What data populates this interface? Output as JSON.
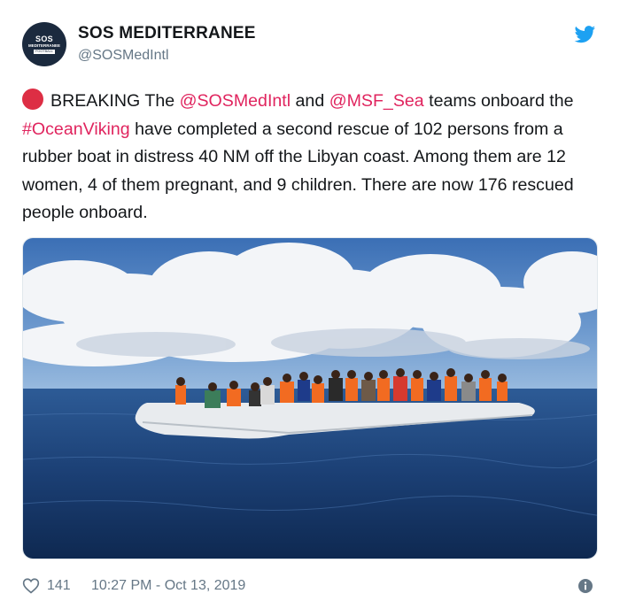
{
  "account": {
    "name": "SOS MEDITERRANEE",
    "handle": "@SOSMedIntl",
    "avatar_line1": "SOS",
    "avatar_line2": "MEDITERRANEE",
    "avatar_line3": "FOOTBALL"
  },
  "tweet": {
    "emoji": "red-circle",
    "segments": [
      {
        "text": "BREAKING The ",
        "link": false
      },
      {
        "text": "@SOSMedIntl",
        "link": true
      },
      {
        "text": " and ",
        "link": false
      },
      {
        "text": "@MSF_Sea",
        "link": true
      },
      {
        "text": " teams onboard the ",
        "link": false
      },
      {
        "text": "#OceanViking",
        "link": true
      },
      {
        "text": " have completed a second rescue of 102 persons from a rubber boat in distress 40 NM off the Libyan coast. Among them are 12 women, 4 of them pregnant, and 9 children. There are now 176 rescued people onboard.",
        "link": false
      }
    ]
  },
  "footer": {
    "likes": "141",
    "timestamp": "10:27 PM - Oct 13, 2019"
  },
  "icons": {
    "brand": "twitter-bird-icon",
    "like": "heart-icon",
    "info": "info-icon"
  },
  "colors": {
    "link": "#e0245e",
    "twitter_blue": "#1da1f2",
    "muted": "#657786",
    "emoji_red": "#dd2e44"
  }
}
